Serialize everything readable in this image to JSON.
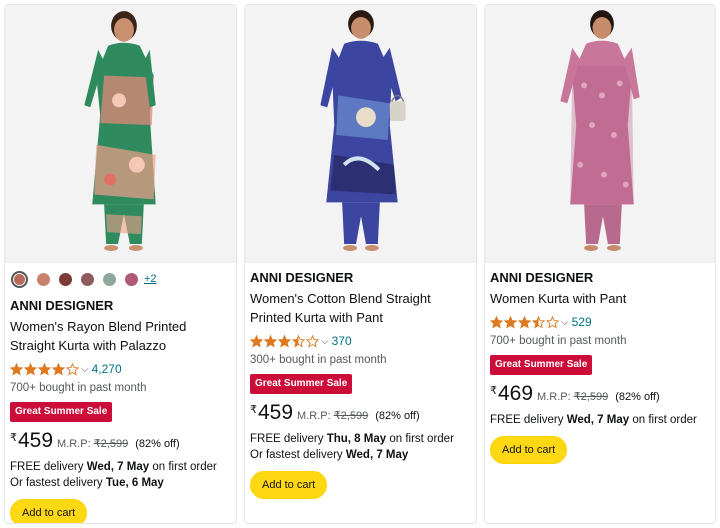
{
  "currency_symbol": "₹",
  "mrp_label": "M.R.P:",
  "delivery_prefix": "FREE delivery",
  "fastest_prefix": "Or fastest delivery",
  "first_order_suffix": "on first order",
  "cart_label": "Add to cart",
  "products": [
    {
      "brand": "ANNI DESIGNER",
      "title": "Women's Rayon Blend Printed Straight Kurta with Palazzo",
      "rating": 4.0,
      "rating_count": "4,270",
      "bought": "700+ bought in past month",
      "badge": "Great Summer Sale",
      "price": "459",
      "mrp": "₹2,599",
      "discount": "(82% off)",
      "delivery_date": "Wed, 7 May",
      "fastest_date": "Tue, 6 May",
      "swatches": [
        "#b86b5c",
        "#c9806f",
        "#7b3b36",
        "#8f5a5e",
        "#8fa89a",
        "#b05a7a"
      ],
      "more_colors": "+2"
    },
    {
      "brand": "ANNI DESIGNER",
      "title": "Women's Cotton Blend Straight Printed Kurta with Pant",
      "rating": 3.5,
      "rating_count": "370",
      "bought": "300+ bought in past month",
      "badge": "Great Summer Sale",
      "price": "459",
      "mrp": "₹2,599",
      "discount": "(82% off)",
      "delivery_date": "Thu, 8 May",
      "fastest_date": "Wed, 7 May"
    },
    {
      "brand": "ANNI DESIGNER",
      "title": "Women Kurta with Pant",
      "rating": 3.5,
      "rating_count": "529",
      "bought": "700+ bought in past month",
      "badge": "Great Summer Sale",
      "price": "469",
      "mrp": "₹2,599",
      "discount": "(82% off)",
      "delivery_date": "Wed, 7 May"
    }
  ],
  "colors": {
    "star": "#de7921",
    "link": "#007185",
    "badge": "#cc0c39",
    "button": "#ffd814"
  }
}
